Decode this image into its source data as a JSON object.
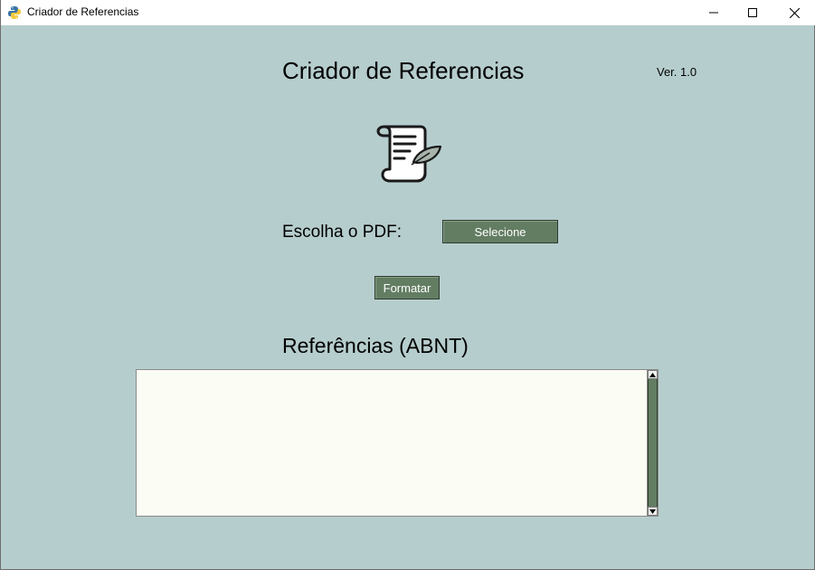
{
  "window": {
    "title": "Criador de Referencias",
    "icon": "python-icon",
    "controls": [
      "minimize-icon",
      "maximize-icon",
      "close-icon"
    ]
  },
  "main": {
    "heading": "Criador de Referencias",
    "version": "Ver. 1.0",
    "logo_icon": "scroll-quill-icon",
    "pdf_label": "Escolha o PDF:",
    "select_button": "Selecione",
    "format_button": "Formatar",
    "references_heading": "Referências (ABNT)",
    "references_text": ""
  },
  "colors": {
    "background": "#b6cdcd",
    "button": "#637d63",
    "button_text": "#ffffff",
    "textarea": "#fbfcf3"
  }
}
